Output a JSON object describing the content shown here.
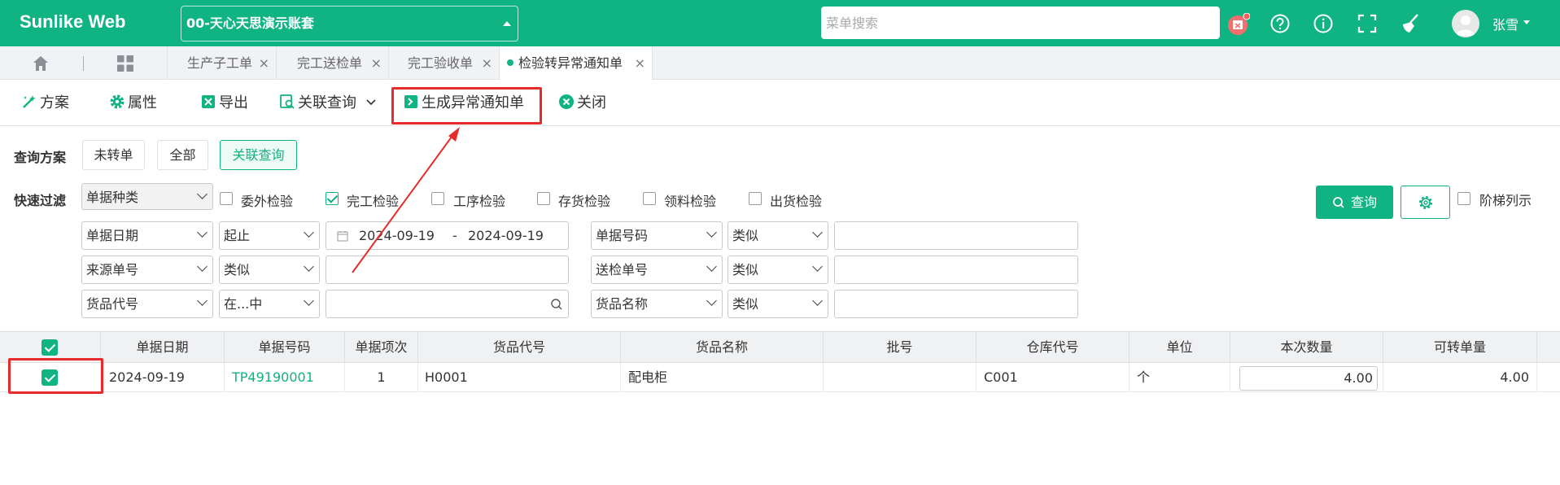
{
  "app": {
    "logo": "Sunlike Web",
    "account": "00-天心天思演示账套"
  },
  "topbar": {
    "search_placeholder": "菜单搜索",
    "user_name": "张雪",
    "icons": [
      "calendar-icon",
      "help-icon",
      "info-icon",
      "fullscreen-icon",
      "clean-icon"
    ],
    "accent": "#10b382"
  },
  "tabs": [
    {
      "label": "生产子工单"
    },
    {
      "label": "完工送检单"
    },
    {
      "label": "完工验收单"
    },
    {
      "label": "检验转异常通知单",
      "active": true
    }
  ],
  "toolbar": {
    "scheme": "方案",
    "props": "属性",
    "export": "导出",
    "related": "关联查询",
    "generate": "生成异常通知单",
    "close": "关闭"
  },
  "query": {
    "scheme_label": "查询方案",
    "scheme_options": [
      "未转单",
      "全部",
      "关联查询"
    ],
    "filter_label": "快速过滤",
    "doc_type": "单据种类",
    "checks": [
      {
        "label": "委外检验",
        "checked": false
      },
      {
        "label": "完工检验",
        "checked": true
      },
      {
        "label": "工序检验",
        "checked": false
      },
      {
        "label": "存货检验",
        "checked": false
      },
      {
        "label": "领料检验",
        "checked": false
      },
      {
        "label": "出货检验",
        "checked": false
      }
    ],
    "rows": [
      {
        "field": "单据日期",
        "op": "起止",
        "date_from": "2024-09-19",
        "date_sep": "-",
        "date_to": "2024-09-19",
        "field2": "单据号码",
        "op2": "类似"
      },
      {
        "field": "来源单号",
        "op": "类似",
        "field2": "送检单号",
        "op2": "类似"
      },
      {
        "field": "货品代号",
        "op": "在...中",
        "field2": "货品名称",
        "op2": "类似"
      }
    ],
    "query_button": "查询",
    "ladder_label": "阶梯列示"
  },
  "grid": {
    "columns": [
      "单据日期",
      "单据号码",
      "单据项次",
      "货品代号",
      "货品名称",
      "批号",
      "仓库代号",
      "单位",
      "本次数量",
      "可转单量"
    ],
    "rows": [
      {
        "date": "2024-09-19",
        "doc_no": "TP49190001",
        "item": "1",
        "code": "H0001",
        "name": "配电柜",
        "batch": "",
        "wh": "C001",
        "unit": "个",
        "qty": "4.00",
        "convertible": "4.00"
      }
    ]
  }
}
